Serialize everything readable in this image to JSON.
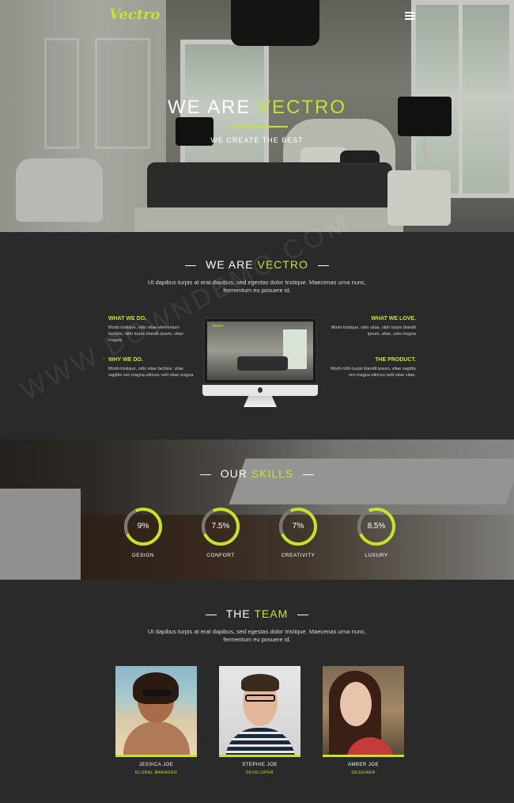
{
  "brand": {
    "logo": "Vectro",
    "accent": "#c6e22b"
  },
  "hero": {
    "title_prefix": "WE ARE",
    "title_accent": "VECTRO",
    "subtitle": "WE CREATE THE BEST"
  },
  "about": {
    "title_prefix": "WE ARE",
    "title_accent": "VECTRO",
    "text": "Ut dapibus turpis at erat dapibus, sed egestas dolor tristique. Maecenas urna nunc, fermentum eu posuere id.",
    "features": [
      {
        "title": "WHAT WE DO.",
        "text": "Morbi tristique, odio vitae elementum facilisis, nibh turpis blandit ipsum, vitae magna"
      },
      {
        "title": "WHY WE DO.",
        "text": "Morbi tristique, odio vitae facilisis, vitae sagittis orci magna ultrices velit vitae magna"
      },
      {
        "title": "WHAT WE LOVE.",
        "text": "Morbi tristique, odio vitae, nibh turpis blandit ipsum, vitae, odio magna"
      },
      {
        "title": "THE PRODUCT.",
        "text": "Morbi nibh turpis blandit ipsum, vitae sagittis orci magna ultrices velit vitae vitae."
      }
    ],
    "monitor_logo": "Vectro"
  },
  "skills": {
    "title_prefix": "OUR",
    "title_accent": "SKILLS",
    "items": [
      {
        "value": "9%",
        "label": "DESIGN"
      },
      {
        "value": "7.5%",
        "label": "CONFORT"
      },
      {
        "value": "7%",
        "label": "CREATIVITY"
      },
      {
        "value": "8.5%",
        "label": "LUXURY"
      }
    ]
  },
  "team": {
    "title_prefix": "THE",
    "title_accent": "TEAM",
    "text": "Ut dapibus turpis at erat dapibus, sed egestas dolor tristique. Maecenas urna nunc, fermentum eu posuere id.",
    "members": [
      {
        "name": "JESSICA JOE",
        "role": "GLOBAL MANAGER"
      },
      {
        "name": "STEPHIE JOE",
        "role": "DEVELOPER"
      },
      {
        "name": "AMBER JOE",
        "role": "DESIGNER"
      }
    ]
  },
  "watermark": "WWW.DOWNDEMO.COM"
}
